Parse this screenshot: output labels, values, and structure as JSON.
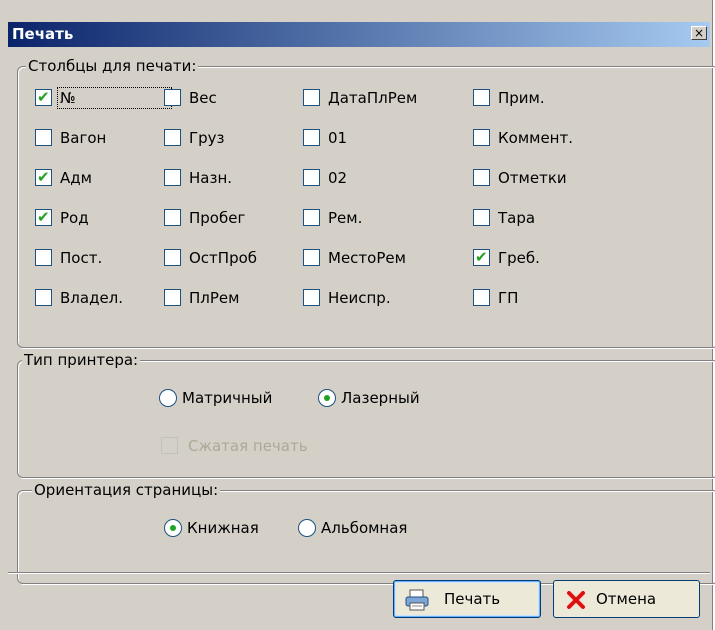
{
  "dialog": {
    "title": "Печать",
    "close_glyph": "×"
  },
  "columns_group": {
    "legend": "Столбцы для печати:",
    "items": [
      {
        "label": "№",
        "checked": true
      },
      {
        "label": "Вес",
        "checked": false
      },
      {
        "label": "ДатаПлРем",
        "checked": false
      },
      {
        "label": "Прим.",
        "checked": false
      },
      {
        "label": "Вагон",
        "checked": false
      },
      {
        "label": "Груз",
        "checked": false
      },
      {
        "label": "01",
        "checked": false
      },
      {
        "label": "Коммент.",
        "checked": false
      },
      {
        "label": "Адм",
        "checked": true
      },
      {
        "label": "Назн.",
        "checked": false
      },
      {
        "label": "02",
        "checked": false
      },
      {
        "label": "Отметки",
        "checked": false
      },
      {
        "label": "Род",
        "checked": true
      },
      {
        "label": "Пробег",
        "checked": false
      },
      {
        "label": "Рем.",
        "checked": false
      },
      {
        "label": "Тара",
        "checked": false
      },
      {
        "label": "Пост.",
        "checked": false
      },
      {
        "label": "ОстПроб",
        "checked": false
      },
      {
        "label": "МестоРем",
        "checked": false
      },
      {
        "label": "Греб.",
        "checked": true
      },
      {
        "label": "Владел.",
        "checked": false
      },
      {
        "label": "ПлРем",
        "checked": false
      },
      {
        "label": "Неиспр.",
        "checked": false
      },
      {
        "label": "ГП",
        "checked": false
      }
    ]
  },
  "printer_group": {
    "legend": "Тип принтера:",
    "option_matrix": "Матричный",
    "option_laser": "Лазерный",
    "selected": "laser",
    "compressed_label": "Сжатая печать",
    "compressed_checked": false,
    "compressed_enabled": false
  },
  "orientation_group": {
    "legend": "Ориентация страницы:",
    "option_portrait": "Книжная",
    "option_landscape": "Альбомная",
    "selected": "portrait"
  },
  "buttons": {
    "print_label": "Печать",
    "cancel_label": "Отмена"
  },
  "colors": {
    "title_start": "#0a246a",
    "title_end": "#a6caf0",
    "check_mark": "#21a121",
    "cancel_x": "#e01010"
  }
}
